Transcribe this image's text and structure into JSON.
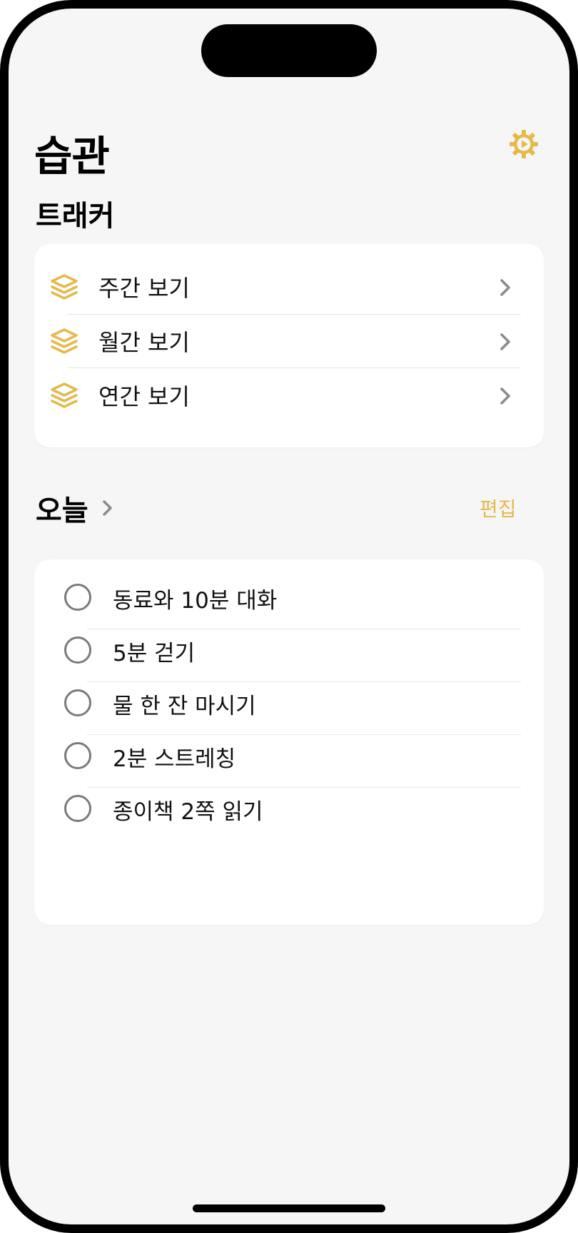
{
  "header": {
    "title": "습관",
    "settings_icon": "gear-icon",
    "accent_color": "#e5b94a"
  },
  "tracker": {
    "section_title": "트래커",
    "items": [
      {
        "label": "주간 보기",
        "icon": "stack-icon"
      },
      {
        "label": "월간 보기",
        "icon": "stack-icon"
      },
      {
        "label": "연간 보기",
        "icon": "stack-icon"
      }
    ]
  },
  "today": {
    "section_title": "오늘",
    "edit_label": "편집",
    "habits": [
      {
        "label": "동료와 10분 대화",
        "checked": false
      },
      {
        "label": "5분 걷기",
        "checked": false
      },
      {
        "label": "물 한 잔 마시기",
        "checked": false
      },
      {
        "label": "2분 스트레칭",
        "checked": false
      },
      {
        "label": "종이책 2쪽 읽기",
        "checked": false
      }
    ]
  }
}
